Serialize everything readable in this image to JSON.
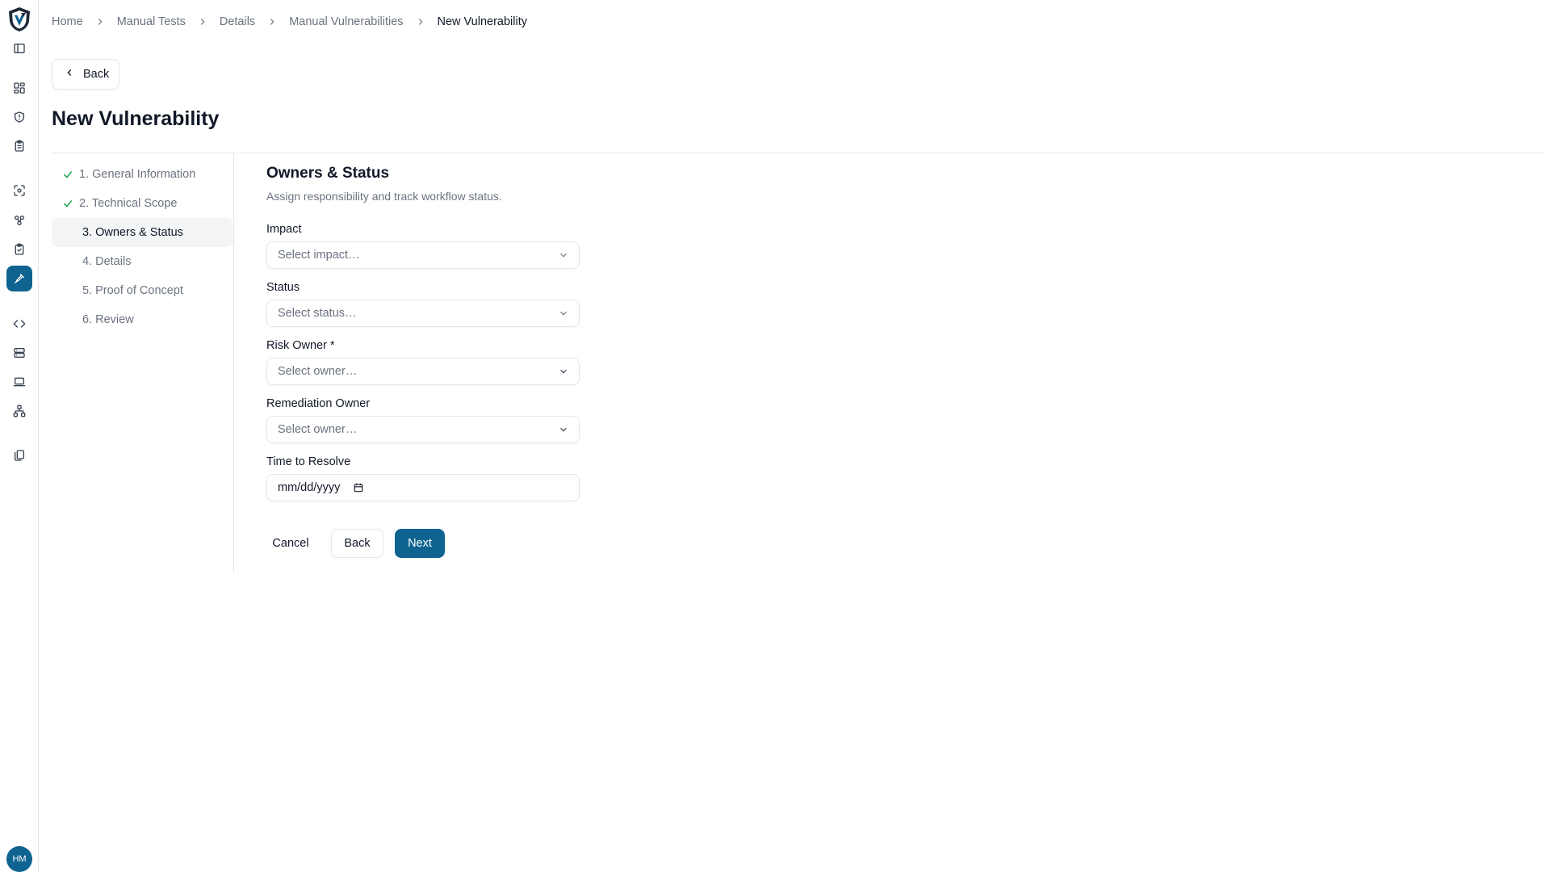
{
  "breadcrumb": [
    "Home",
    "Manual Tests",
    "Details",
    "Manual Vulnerabilities",
    "New Vulnerability"
  ],
  "back_label": "Back",
  "page_title": "New Vulnerability",
  "steps": [
    {
      "label": "1. General Information",
      "state": "done"
    },
    {
      "label": "2. Technical Scope",
      "state": "done"
    },
    {
      "label": "3. Owners & Status",
      "state": "active"
    },
    {
      "label": "4. Details",
      "state": "pending"
    },
    {
      "label": "5. Proof of Concept",
      "state": "pending"
    },
    {
      "label": "6. Review",
      "state": "pending"
    }
  ],
  "form": {
    "title": "Owners & Status",
    "subtitle": "Assign responsibility and track workflow status.",
    "impact": {
      "label": "Impact",
      "placeholder": "Select impact…"
    },
    "status": {
      "label": "Status",
      "placeholder": "Select status…"
    },
    "risk_owner": {
      "label": "Risk Owner *",
      "placeholder": "Select owner…"
    },
    "remediation_owner": {
      "label": "Remediation Owner",
      "placeholder": "Select owner…"
    },
    "time_to_resolve": {
      "label": "Time to Resolve",
      "value": "mm/dd/yyyy"
    }
  },
  "actions": {
    "cancel": "Cancel",
    "back": "Back",
    "next": "Next"
  },
  "user": {
    "initials": "HM"
  },
  "colors": {
    "accent": "#0e6390",
    "check": "#16a34a"
  },
  "rail_icons": [
    "logo-shield-icon",
    "sidebar-toggle-icon",
    "dashboard-icon",
    "shield-icon",
    "clipboard-icon",
    "scan-icon",
    "integrations-icon",
    "clipboard-check-icon",
    "manual-tests-icon",
    "code-icon",
    "server-icon",
    "laptop-icon",
    "network-icon",
    "documents-icon"
  ]
}
